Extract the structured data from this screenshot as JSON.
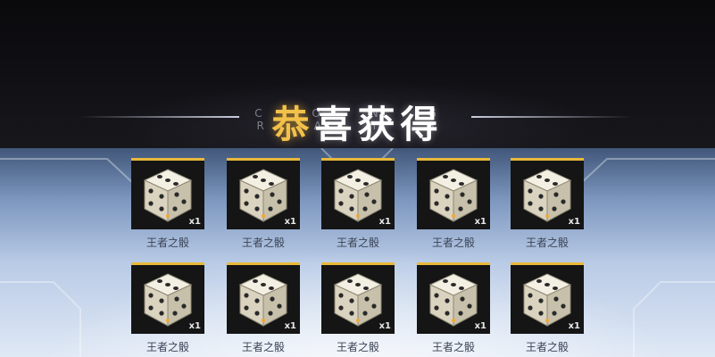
{
  "header": {
    "title_first": "恭",
    "title_rest": "喜获得",
    "title_bg_text": "C O N G R A T S"
  },
  "rewards": [
    {
      "name": "王者之骰",
      "qty": "x1",
      "icon": "dice-icon"
    },
    {
      "name": "王者之骰",
      "qty": "x1",
      "icon": "dice-icon"
    },
    {
      "name": "王者之骰",
      "qty": "x1",
      "icon": "dice-icon"
    },
    {
      "name": "王者之骰",
      "qty": "x1",
      "icon": "dice-icon"
    },
    {
      "name": "王者之骰",
      "qty": "x1",
      "icon": "dice-icon"
    },
    {
      "name": "王者之骰",
      "qty": "x1",
      "icon": "dice-icon"
    },
    {
      "name": "王者之骰",
      "qty": "x1",
      "icon": "dice-icon"
    },
    {
      "name": "王者之骰",
      "qty": "x1",
      "icon": "dice-icon"
    },
    {
      "name": "王者之骰",
      "qty": "x1",
      "icon": "dice-icon"
    },
    {
      "name": "王者之骰",
      "qty": "x1",
      "icon": "dice-icon"
    }
  ],
  "colors": {
    "accent_gold": "#e9b93a",
    "title_gold": "#f2c14a",
    "tile_bg": "#151515"
  }
}
